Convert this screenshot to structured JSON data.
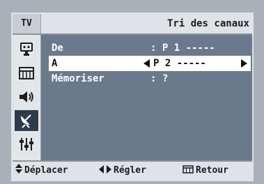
{
  "header": {
    "tab_label": "TV",
    "title": "Tri des canaux"
  },
  "sidebar": {
    "items": [
      {
        "icon": "antenna-plug-icon",
        "active": false
      },
      {
        "icon": "picture-icon",
        "active": false
      },
      {
        "icon": "speaker-icon",
        "active": false
      },
      {
        "icon": "satellite-dish-icon",
        "active": true
      },
      {
        "icon": "settings-sliders-icon",
        "active": false
      }
    ]
  },
  "menu": {
    "rows": [
      {
        "label": "De",
        "value": ": P 1 -----",
        "selected": false
      },
      {
        "label": "A",
        "value": "P 2 -----",
        "selected": true
      },
      {
        "label": "Mémoriser",
        "value": ": ?",
        "selected": false
      }
    ]
  },
  "footer": {
    "move_icon": "up-down-arrows-icon",
    "move_label": "Déplacer",
    "adjust_icon": "left-right-arrows-icon",
    "adjust_label": "Régler",
    "return_icon": "menu-icon",
    "return_label": "Retour"
  },
  "colors": {
    "panel": "#6a7a8c",
    "header": "#dfe3e7",
    "highlight": "#ffffff",
    "active_icon_bg": "#2e3b4a",
    "background": "#a9b0b7"
  }
}
